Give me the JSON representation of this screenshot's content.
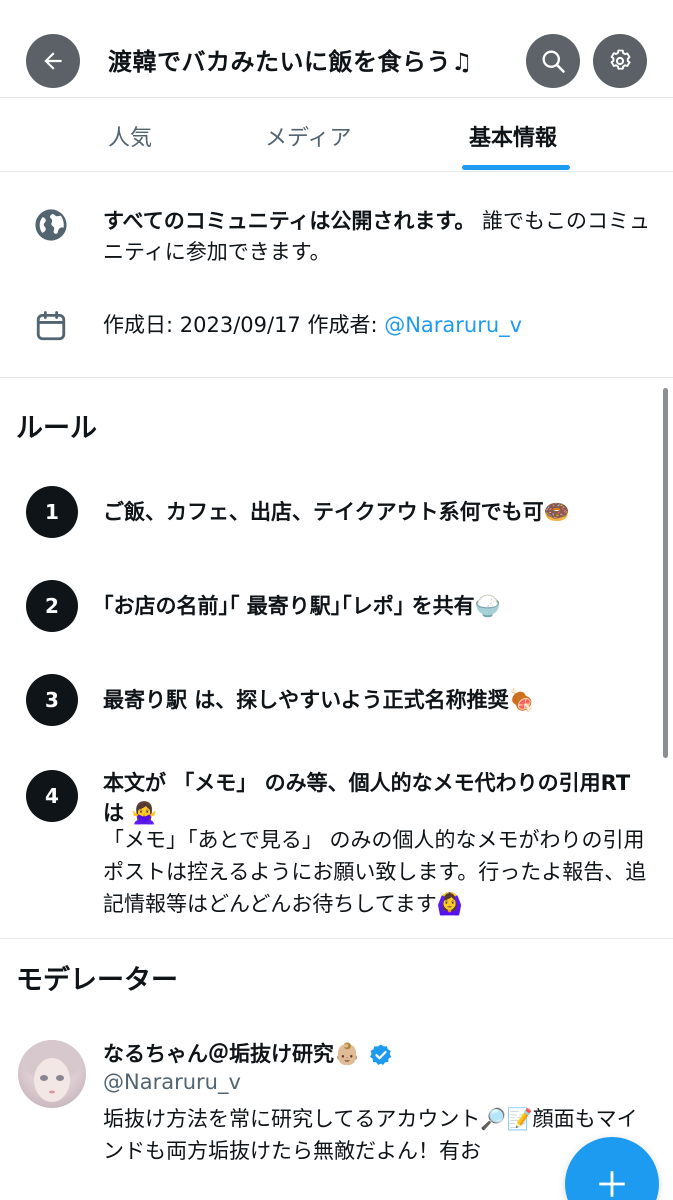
{
  "header": {
    "title": "渡韓でバカみたいに飯を食らう♫",
    "back_icon": "arrow-left-icon",
    "search_icon": "search-icon",
    "settings_icon": "gear-icon"
  },
  "tabs": [
    {
      "label": "人気",
      "active": false
    },
    {
      "label": "メディア",
      "active": false
    },
    {
      "label": "基本情報",
      "active": true
    }
  ],
  "info": {
    "public_bold": "すべてのコミュニティは公開されます。",
    "public_rest": " 誰でもこのコミュニティに参加できます。",
    "created_label": "作成日: 2023/09/17 作成者: ",
    "creator_handle": "@Nararuru_v"
  },
  "rules": {
    "title": "ルール",
    "items": [
      {
        "num": "1",
        "title": "ご飯、カフェ、出店、テイクアウト系何でも可🍩",
        "desc": ""
      },
      {
        "num": "2",
        "title": "｢お店の名前｣｢ 最寄り駅｣｢レポ｣ を共有🍚",
        "desc": ""
      },
      {
        "num": "3",
        "title": "最寄り駅 は、探しやすいよう正式名称推奨🍖",
        "desc": ""
      },
      {
        "num": "4",
        "title": "本文が 「メモ」 のみ等、個人的なメモ代わりの引用RTは 🙅‍♀️",
        "desc": "「メモ」「あとで見る」 のみの個人的なメモがわりの引用ポストは控えるようにお願い致します。行ったよ報告、追記情報等はどんどんお待ちしてます🙆‍♀️"
      }
    ]
  },
  "moderators": {
    "title": "モデレーター",
    "name": "なるちゃん＠垢抜け研究👶🏼",
    "handle": "@Nararuru_v",
    "bio": "垢抜け方法を常に研究してるアカウント🔎📝顔面もマインドも両方垢抜けたら無敵だよん！有お"
  },
  "fab": {
    "icon": "plus-icon"
  },
  "colors": {
    "accent": "#1d9bf0",
    "text": "#0f1419",
    "muted": "#536471"
  }
}
